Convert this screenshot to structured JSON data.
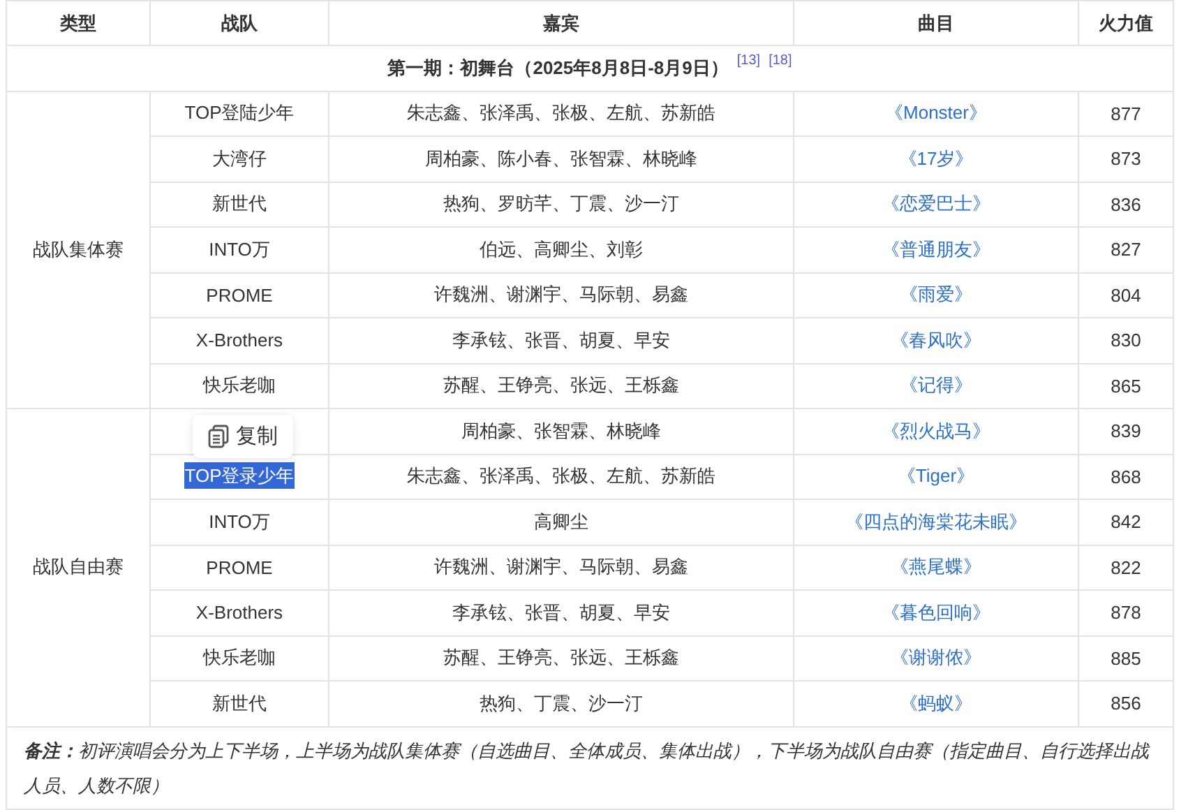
{
  "table": {
    "columns": [
      "类型",
      "战队",
      "嘉宾",
      "曲目",
      "火力值"
    ],
    "stage": {
      "title": "第一期：初舞台（2025年8月8日-8月9日）",
      "refs": [
        "[13]",
        "[18]"
      ]
    },
    "groups": [
      {
        "type": "战队集体赛",
        "rows": [
          {
            "team": "TOP登陆少年",
            "team_selected": false,
            "guests": "朱志鑫、张泽禹、张极、左航、苏新皓",
            "song": "《Monster》",
            "score": "877"
          },
          {
            "team": "大湾仔",
            "team_selected": false,
            "guests": "周柏豪、陈小春、张智霖、林晓峰",
            "song": "《17岁》",
            "score": "873"
          },
          {
            "team": "新世代",
            "team_selected": false,
            "guests": "热狗、罗昉芊、丁震、沙一汀",
            "song": "《恋爱巴士》",
            "score": "836"
          },
          {
            "team": "INTO万",
            "team_selected": false,
            "guests": "伯远、高卿尘、刘彰",
            "song": "《普通朋友》",
            "score": "827"
          },
          {
            "team": "PROME",
            "team_selected": false,
            "guests": "许魏洲、谢渊宇、马际朝、易鑫",
            "song": "《雨爱》",
            "score": "804"
          },
          {
            "team": "X-Brothers",
            "team_selected": false,
            "guests": "李承铉、张晋、胡夏、早安",
            "song": "《春风吹》",
            "score": "830"
          },
          {
            "team": "快乐老咖",
            "team_selected": false,
            "guests": "苏醒、王铮亮、张远、王栎鑫",
            "song": "《记得》",
            "score": "865"
          }
        ]
      },
      {
        "type": "战队自由赛",
        "rows": [
          {
            "guests": "周柏豪、张智霖、林晓峰",
            "song": "《烈火战马》",
            "score": "839",
            "copy_menu": {
              "label": "复制"
            }
          },
          {
            "team": "TOP登录少年",
            "team_selected": true,
            "guests": "朱志鑫、张泽禹、张极、左航、苏新皓",
            "song": "《Tiger》",
            "score": "868"
          },
          {
            "team": "INTO万",
            "team_selected": false,
            "guests": "高卿尘",
            "song": "《四点的海棠花未眠》",
            "score": "842"
          },
          {
            "team": "PROME",
            "team_selected": false,
            "guests": "许魏洲、谢渊宇、马际朝、易鑫",
            "song": "《燕尾蝶》",
            "score": "822"
          },
          {
            "team": "X-Brothers",
            "team_selected": false,
            "guests": "李承铉、张晋、胡夏、早安",
            "song": "《暮色回响》",
            "score": "878"
          },
          {
            "team": "快乐老咖",
            "team_selected": false,
            "guests": "苏醒、王铮亮、张远、王栎鑫",
            "song": "《谢谢侬》",
            "score": "885"
          },
          {
            "team": "新世代",
            "team_selected": false,
            "guests": "热狗、丁震、沙一汀",
            "song": "《蚂蚁》",
            "score": "856"
          }
        ]
      }
    ],
    "note": "**备注：**初评演唱会分为上下半场，上半场为战队集体赛（自选曲目、全体成员、集体出战），下半场为战队自由赛（指定曲目、自行选择出战人员、人数不限）"
  }
}
